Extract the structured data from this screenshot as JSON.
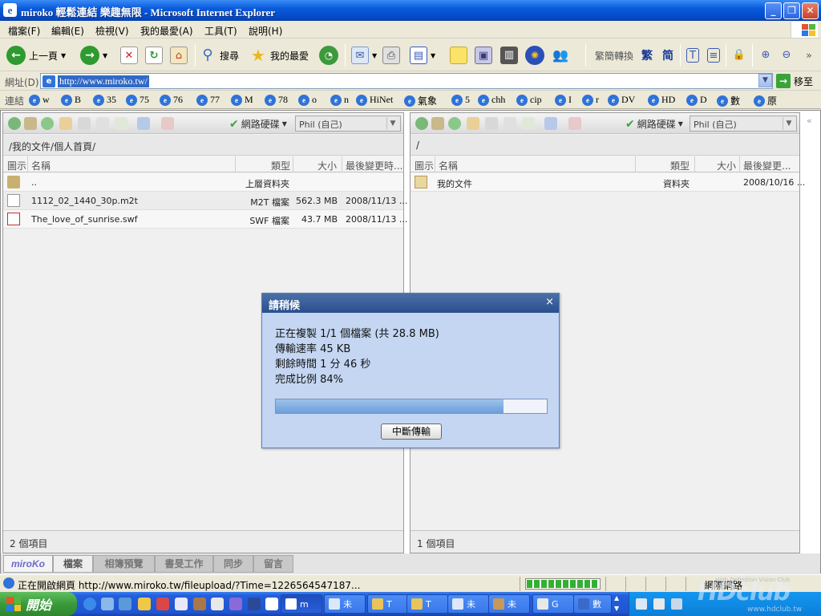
{
  "window": {
    "title": "miroko 輕鬆連結 樂趣無限 - Microsoft Internet Explorer"
  },
  "menu": [
    "檔案(F)",
    "編輯(E)",
    "檢視(V)",
    "我的最愛(A)",
    "工具(T)",
    "說明(H)"
  ],
  "toolbar": {
    "back": "上一頁",
    "search": "搜尋",
    "favorites": "我的最愛",
    "convert": "繁簡轉換",
    "trad": "繁",
    "simp": "简"
  },
  "address": {
    "label": "網址(D)",
    "url": "http://www.miroko.tw/",
    "go": "移至"
  },
  "links": {
    "label": "連結",
    "items": [
      "w",
      "B",
      "35",
      "75",
      "76",
      "77",
      "M",
      "78",
      "o",
      "n",
      "HiNet",
      "氣象",
      "5",
      "chh",
      "cip",
      "I",
      "r",
      "DV",
      "HD",
      "D",
      "數",
      "原"
    ]
  },
  "left_panel": {
    "drive": "網路硬碟",
    "user": "Phil (自己)",
    "path": "/我的文件/個人首頁/",
    "headers": {
      "icon": "圖示",
      "name": "名稱",
      "type": "類型",
      "size": "大小",
      "modified": "最後變更時..."
    },
    "rows": [
      {
        "name": "..",
        "type": "上層資料夾",
        "size": "",
        "modified": ""
      },
      {
        "name": "1112_02_1440_30p.m2t",
        "type": "M2T 檔案",
        "size": "562.3 MB",
        "modified": "2008/11/13 ..."
      },
      {
        "name": "The_love_of_sunrise.swf",
        "type": "SWF 檔案",
        "size": "43.7 MB",
        "modified": "2008/11/13 ..."
      }
    ],
    "status": "2 個項目"
  },
  "right_panel": {
    "drive": "網路硬碟",
    "user": "Phil (自己)",
    "path": "/",
    "headers": {
      "icon": "圖示",
      "name": "名稱",
      "type": "類型",
      "size": "大小",
      "modified": "最後變更..."
    },
    "rows": [
      {
        "name": "我的文件",
        "type": "資料夾",
        "size": "",
        "modified": "2008/10/16 ..."
      }
    ],
    "status": "1 個項目"
  },
  "tabs": [
    "miroKo",
    "檔案",
    "相簿預覽",
    "書旻工作",
    "同步",
    "留言"
  ],
  "dialog": {
    "title": "請稍候",
    "line1": "正在複製 1/1 個檔案 (共 28.8 MB)",
    "line2": "傳輸速率 45 KB",
    "line3": "剩餘時間 1 分 46 秒",
    "line4": "完成比例 84%",
    "progress": 0.84,
    "cancel": "中斷傳輸"
  },
  "statusbar": {
    "text": "正在開啟網頁 http://www.miroko.tw/fileupload/?Time=1226564547187...",
    "zone": "網際網路"
  },
  "taskbar": {
    "start": "開始",
    "tasks": [
      "m",
      "未",
      "T",
      "T",
      "未",
      "未",
      "G",
      "數"
    ]
  },
  "watermark": {
    "logo": "HDclub",
    "tagline": "High Definition Vision Club",
    "url": "www.hdclub.tw"
  },
  "colors": {
    "accent": "#0a5bdc",
    "dialog_bg": "#c4d6f2",
    "progress": "#6d9fd8"
  }
}
